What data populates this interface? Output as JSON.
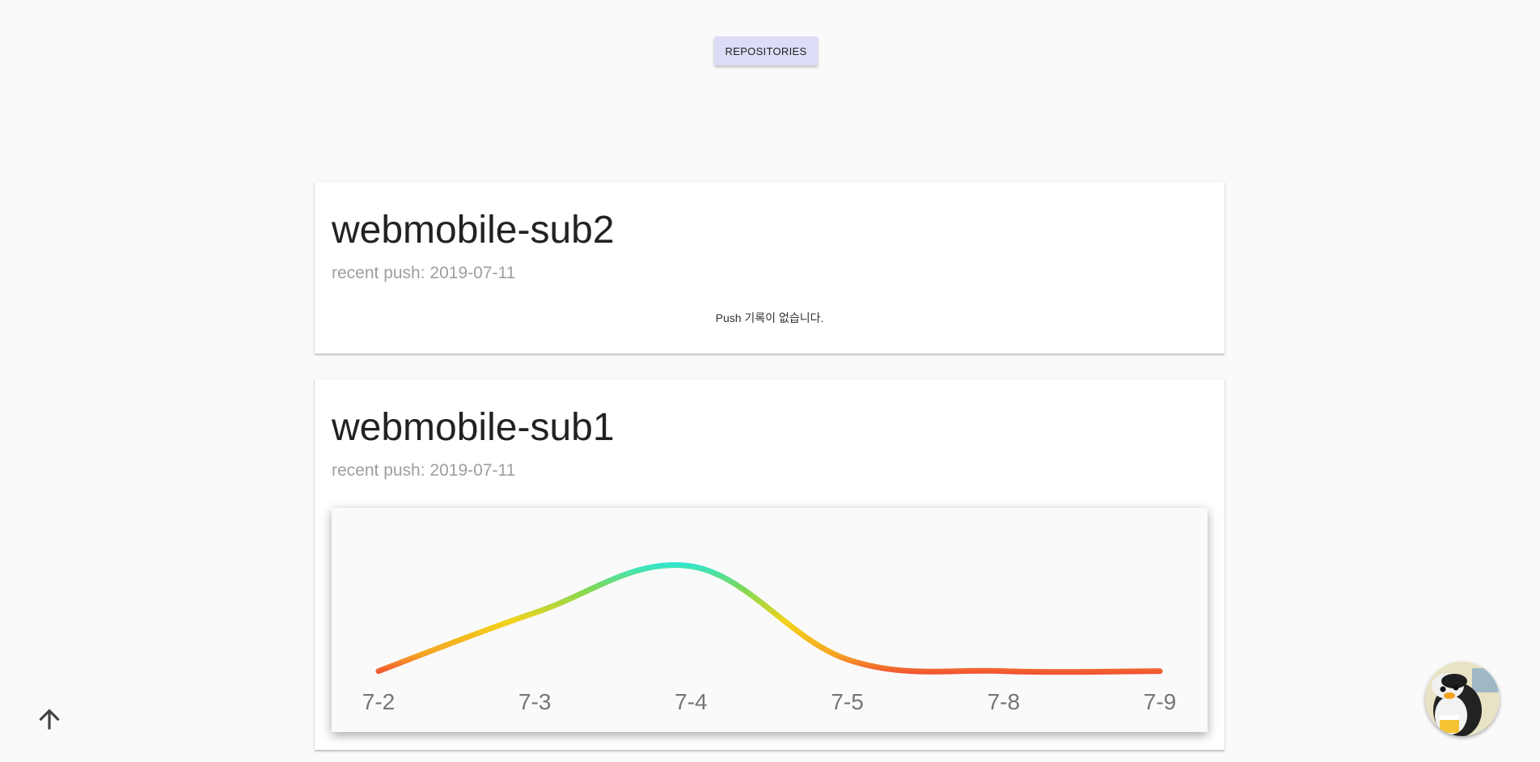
{
  "header": {
    "repositories_button": "REPOSITORIES"
  },
  "repos": [
    {
      "name": "webmobile-sub2",
      "recent_push": "recent push: 2019-07-11",
      "empty_message": "Push 기록이 없습니다."
    },
    {
      "name": "webmobile-sub1",
      "recent_push": "recent push: 2019-07-11"
    }
  ],
  "chart_data": {
    "type": "line",
    "categories": [
      "7-2",
      "7-3",
      "7-4",
      "7-5",
      "7-8",
      "7-9"
    ],
    "values": [
      1,
      6,
      10,
      2,
      1,
      1
    ],
    "ylim": [
      0,
      10
    ],
    "grid": false,
    "gradient_colors": [
      "#f0203c",
      "#f5a623",
      "#f2d31b",
      "#7ed957",
      "#1de9f0"
    ]
  },
  "icons": {
    "scroll_top": "arrow-up-icon",
    "avatar": "penguin-avatar"
  }
}
